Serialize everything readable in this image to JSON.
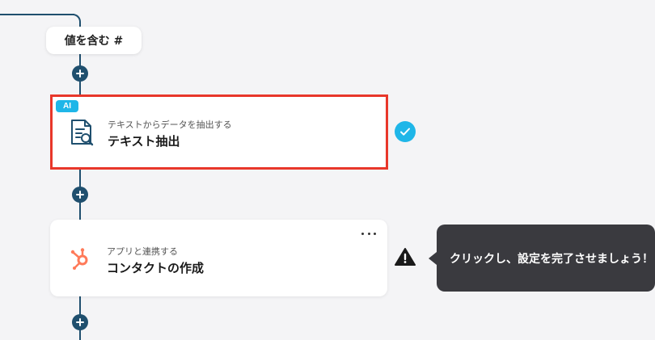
{
  "condition_chip": {
    "label": "値を含む #"
  },
  "steps": [
    {
      "badge": "AI",
      "subtitle": "テキストからデータを抽出する",
      "title": "テキスト抽出",
      "icon": "document-search-icon",
      "status": "completed",
      "highlight_color": "#e8372a"
    },
    {
      "subtitle": "アプリと連携する",
      "title": "コンタクトの作成",
      "icon": "hubspot-icon",
      "status": "warning",
      "menu_icon": "more-horizontal-icon"
    }
  ],
  "tooltip": {
    "text": "クリックし、設定を完了させましょう！"
  },
  "colors": {
    "connector": "#1f4f6e",
    "accent": "#1fb6e8",
    "hubspot": "#ff7a59",
    "tooltip_bg": "#3a3a3f"
  }
}
